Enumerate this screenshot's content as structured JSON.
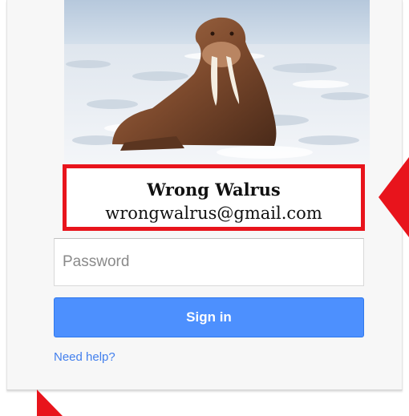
{
  "account": {
    "name": "Wrong Walrus",
    "email": "wrongwalrus@gmail.com"
  },
  "password_field": {
    "placeholder": "Password",
    "value": ""
  },
  "signin_label": "Sign in",
  "help_link": "Need help?",
  "colors": {
    "signin_blue": "#4d90fe",
    "link_blue": "#427fed",
    "highlight_red": "#e8141c"
  }
}
